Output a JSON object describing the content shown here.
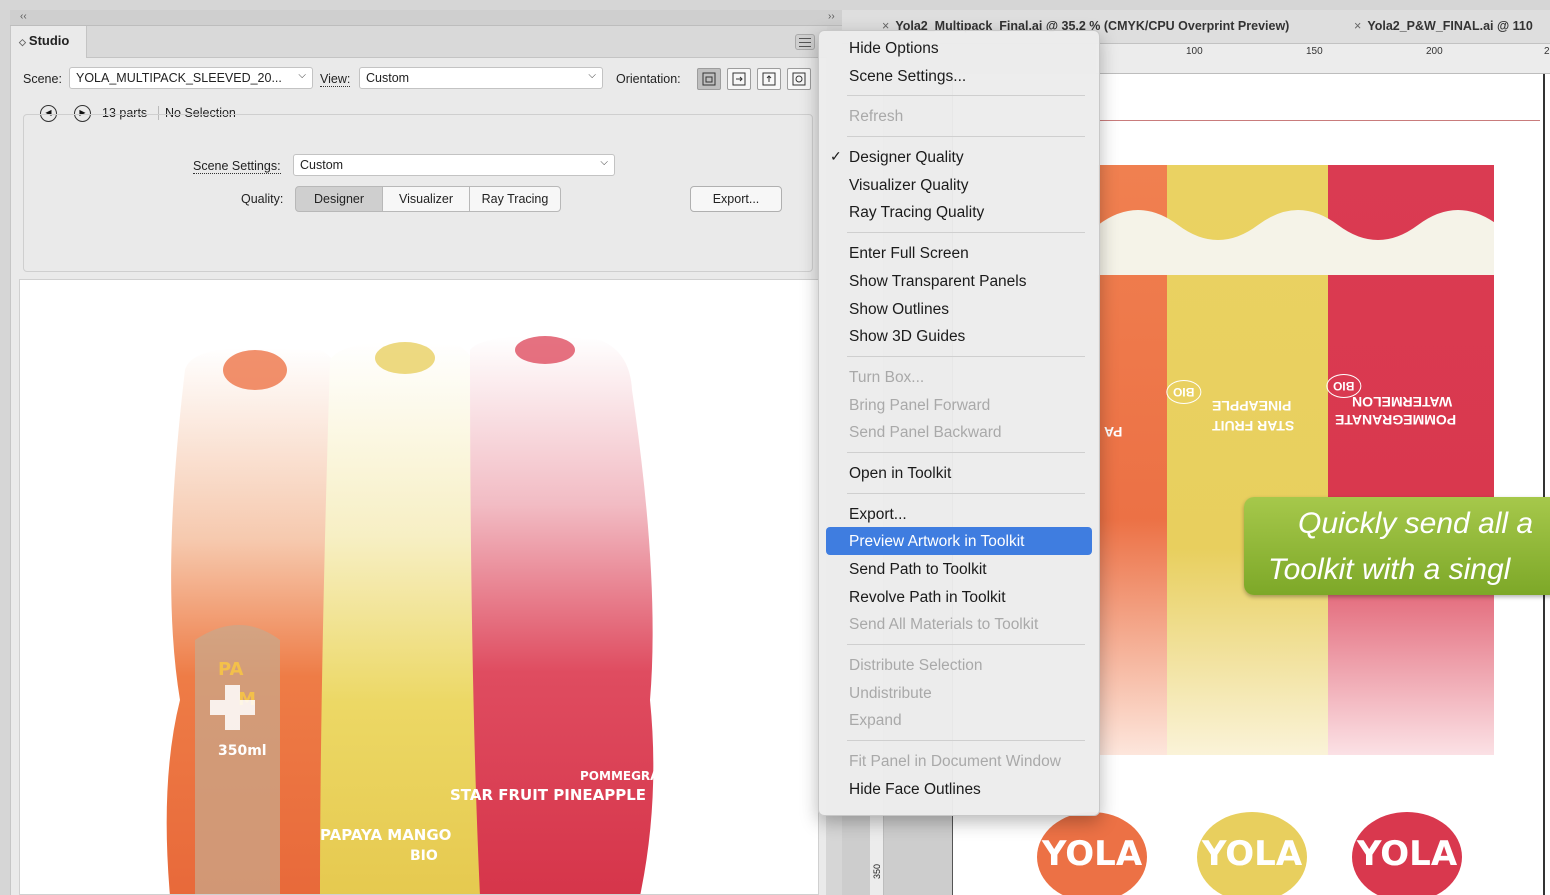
{
  "studio": {
    "tab_title": "Studio",
    "scene_label": "Scene:",
    "scene_value": "YOLA_MULTIPACK_SLEEVED_20...",
    "view_label": "View:",
    "view_value": "Custom",
    "orientation_label": "Orientation:",
    "parts_count": "13 parts",
    "selection_status": "No Selection",
    "scene_settings_label": "Scene Settings:",
    "scene_settings_value": "Custom",
    "quality_label": "Quality:",
    "quality_options": [
      "Designer",
      "Visualizer",
      "Ray Tracing"
    ],
    "export_button": "Export..."
  },
  "bottle_labels": {
    "papaya": "PAPAYA MANGO",
    "starfruit": "STAR FRUIT PINEAPPLE",
    "pomegranate": "POMMEGRANATE WATERMELON",
    "bio": "BIO",
    "volume": "350ml",
    "side_pa": "PA",
    "side_ma": "M"
  },
  "document": {
    "tab1": "Yola2_Multipack_Final.ai @ 35,2 % (CMYK/CPU Overprint Preview)",
    "tab2": "Yola2_P&W_FINAL.ai @ 110",
    "ruler_ticks": [
      "100",
      "150",
      "200",
      "2"
    ],
    "ruler_left_tick": "350",
    "flipped_labels": [
      "STAR FRUIT",
      "PINEAPPLE",
      "WATERMELON",
      "POMMEGRANATE",
      "PA"
    ],
    "bio": "BIO",
    "logo_text": "YOLA",
    "callout_line1": "Quickly send all a",
    "callout_line2": "Toolkit with a singl"
  },
  "menu": {
    "items": [
      {
        "label": "Hide Options",
        "state": "normal"
      },
      {
        "label": "Scene Settings...",
        "state": "normal"
      },
      {
        "sep": true
      },
      {
        "label": "Refresh",
        "state": "disabled"
      },
      {
        "sep": true
      },
      {
        "label": "Designer Quality",
        "state": "checked"
      },
      {
        "label": "Visualizer Quality",
        "state": "normal"
      },
      {
        "label": "Ray Tracing Quality",
        "state": "normal"
      },
      {
        "sep": true
      },
      {
        "label": "Enter Full Screen",
        "state": "normal"
      },
      {
        "label": "Show Transparent Panels",
        "state": "normal"
      },
      {
        "label": "Show Outlines",
        "state": "normal"
      },
      {
        "label": "Show 3D Guides",
        "state": "normal"
      },
      {
        "sep": true
      },
      {
        "label": "Turn Box...",
        "state": "disabled"
      },
      {
        "label": "Bring Panel Forward",
        "state": "disabled"
      },
      {
        "label": "Send Panel Backward",
        "state": "disabled"
      },
      {
        "sep": true
      },
      {
        "label": "Open in Toolkit",
        "state": "normal"
      },
      {
        "sep": true
      },
      {
        "label": "Export...",
        "state": "normal"
      },
      {
        "label": "Preview Artwork in Toolkit",
        "state": "highlight"
      },
      {
        "label": "Send Path to Toolkit",
        "state": "normal"
      },
      {
        "label": "Revolve Path in Toolkit",
        "state": "normal"
      },
      {
        "label": "Send All Materials to Toolkit",
        "state": "disabled"
      },
      {
        "sep": true
      },
      {
        "label": "Distribute Selection",
        "state": "disabled"
      },
      {
        "label": "Undistribute",
        "state": "disabled"
      },
      {
        "label": "Expand",
        "state": "disabled"
      },
      {
        "sep": true
      },
      {
        "label": "Fit Panel in Document Window",
        "state": "disabled"
      },
      {
        "label": "Hide Face Outlines",
        "state": "normal"
      }
    ]
  },
  "colors": {
    "orange": "#ec7145",
    "yellow": "#e8cf5e",
    "red": "#d9384e",
    "highlight": "#3f7de0",
    "callout_green": "#8db636"
  }
}
